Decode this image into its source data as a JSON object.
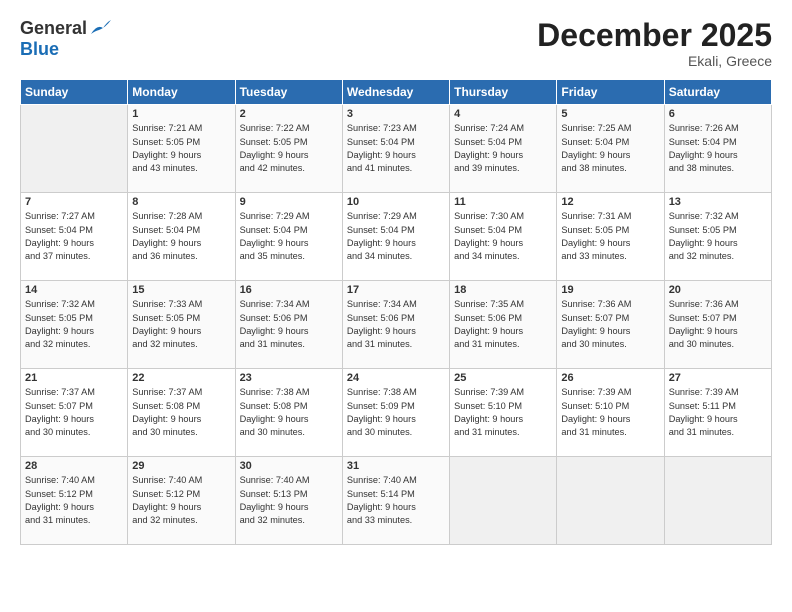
{
  "header": {
    "logo_general": "General",
    "logo_blue": "Blue",
    "month_title": "December 2025",
    "location": "Ekali, Greece"
  },
  "weekdays": [
    "Sunday",
    "Monday",
    "Tuesday",
    "Wednesday",
    "Thursday",
    "Friday",
    "Saturday"
  ],
  "weeks": [
    [
      {
        "day": "",
        "info": ""
      },
      {
        "day": "1",
        "info": "Sunrise: 7:21 AM\nSunset: 5:05 PM\nDaylight: 9 hours\nand 43 minutes."
      },
      {
        "day": "2",
        "info": "Sunrise: 7:22 AM\nSunset: 5:05 PM\nDaylight: 9 hours\nand 42 minutes."
      },
      {
        "day": "3",
        "info": "Sunrise: 7:23 AM\nSunset: 5:04 PM\nDaylight: 9 hours\nand 41 minutes."
      },
      {
        "day": "4",
        "info": "Sunrise: 7:24 AM\nSunset: 5:04 PM\nDaylight: 9 hours\nand 39 minutes."
      },
      {
        "day": "5",
        "info": "Sunrise: 7:25 AM\nSunset: 5:04 PM\nDaylight: 9 hours\nand 38 minutes."
      },
      {
        "day": "6",
        "info": "Sunrise: 7:26 AM\nSunset: 5:04 PM\nDaylight: 9 hours\nand 38 minutes."
      }
    ],
    [
      {
        "day": "7",
        "info": "Sunrise: 7:27 AM\nSunset: 5:04 PM\nDaylight: 9 hours\nand 37 minutes."
      },
      {
        "day": "8",
        "info": "Sunrise: 7:28 AM\nSunset: 5:04 PM\nDaylight: 9 hours\nand 36 minutes."
      },
      {
        "day": "9",
        "info": "Sunrise: 7:29 AM\nSunset: 5:04 PM\nDaylight: 9 hours\nand 35 minutes."
      },
      {
        "day": "10",
        "info": "Sunrise: 7:29 AM\nSunset: 5:04 PM\nDaylight: 9 hours\nand 34 minutes."
      },
      {
        "day": "11",
        "info": "Sunrise: 7:30 AM\nSunset: 5:04 PM\nDaylight: 9 hours\nand 34 minutes."
      },
      {
        "day": "12",
        "info": "Sunrise: 7:31 AM\nSunset: 5:05 PM\nDaylight: 9 hours\nand 33 minutes."
      },
      {
        "day": "13",
        "info": "Sunrise: 7:32 AM\nSunset: 5:05 PM\nDaylight: 9 hours\nand 32 minutes."
      }
    ],
    [
      {
        "day": "14",
        "info": "Sunrise: 7:32 AM\nSunset: 5:05 PM\nDaylight: 9 hours\nand 32 minutes."
      },
      {
        "day": "15",
        "info": "Sunrise: 7:33 AM\nSunset: 5:05 PM\nDaylight: 9 hours\nand 32 minutes."
      },
      {
        "day": "16",
        "info": "Sunrise: 7:34 AM\nSunset: 5:06 PM\nDaylight: 9 hours\nand 31 minutes."
      },
      {
        "day": "17",
        "info": "Sunrise: 7:34 AM\nSunset: 5:06 PM\nDaylight: 9 hours\nand 31 minutes."
      },
      {
        "day": "18",
        "info": "Sunrise: 7:35 AM\nSunset: 5:06 PM\nDaylight: 9 hours\nand 31 minutes."
      },
      {
        "day": "19",
        "info": "Sunrise: 7:36 AM\nSunset: 5:07 PM\nDaylight: 9 hours\nand 30 minutes."
      },
      {
        "day": "20",
        "info": "Sunrise: 7:36 AM\nSunset: 5:07 PM\nDaylight: 9 hours\nand 30 minutes."
      }
    ],
    [
      {
        "day": "21",
        "info": "Sunrise: 7:37 AM\nSunset: 5:07 PM\nDaylight: 9 hours\nand 30 minutes."
      },
      {
        "day": "22",
        "info": "Sunrise: 7:37 AM\nSunset: 5:08 PM\nDaylight: 9 hours\nand 30 minutes."
      },
      {
        "day": "23",
        "info": "Sunrise: 7:38 AM\nSunset: 5:08 PM\nDaylight: 9 hours\nand 30 minutes."
      },
      {
        "day": "24",
        "info": "Sunrise: 7:38 AM\nSunset: 5:09 PM\nDaylight: 9 hours\nand 30 minutes."
      },
      {
        "day": "25",
        "info": "Sunrise: 7:39 AM\nSunset: 5:10 PM\nDaylight: 9 hours\nand 31 minutes."
      },
      {
        "day": "26",
        "info": "Sunrise: 7:39 AM\nSunset: 5:10 PM\nDaylight: 9 hours\nand 31 minutes."
      },
      {
        "day": "27",
        "info": "Sunrise: 7:39 AM\nSunset: 5:11 PM\nDaylight: 9 hours\nand 31 minutes."
      }
    ],
    [
      {
        "day": "28",
        "info": "Sunrise: 7:40 AM\nSunset: 5:12 PM\nDaylight: 9 hours\nand 31 minutes."
      },
      {
        "day": "29",
        "info": "Sunrise: 7:40 AM\nSunset: 5:12 PM\nDaylight: 9 hours\nand 32 minutes."
      },
      {
        "day": "30",
        "info": "Sunrise: 7:40 AM\nSunset: 5:13 PM\nDaylight: 9 hours\nand 32 minutes."
      },
      {
        "day": "31",
        "info": "Sunrise: 7:40 AM\nSunset: 5:14 PM\nDaylight: 9 hours\nand 33 minutes."
      },
      {
        "day": "",
        "info": ""
      },
      {
        "day": "",
        "info": ""
      },
      {
        "day": "",
        "info": ""
      }
    ]
  ]
}
